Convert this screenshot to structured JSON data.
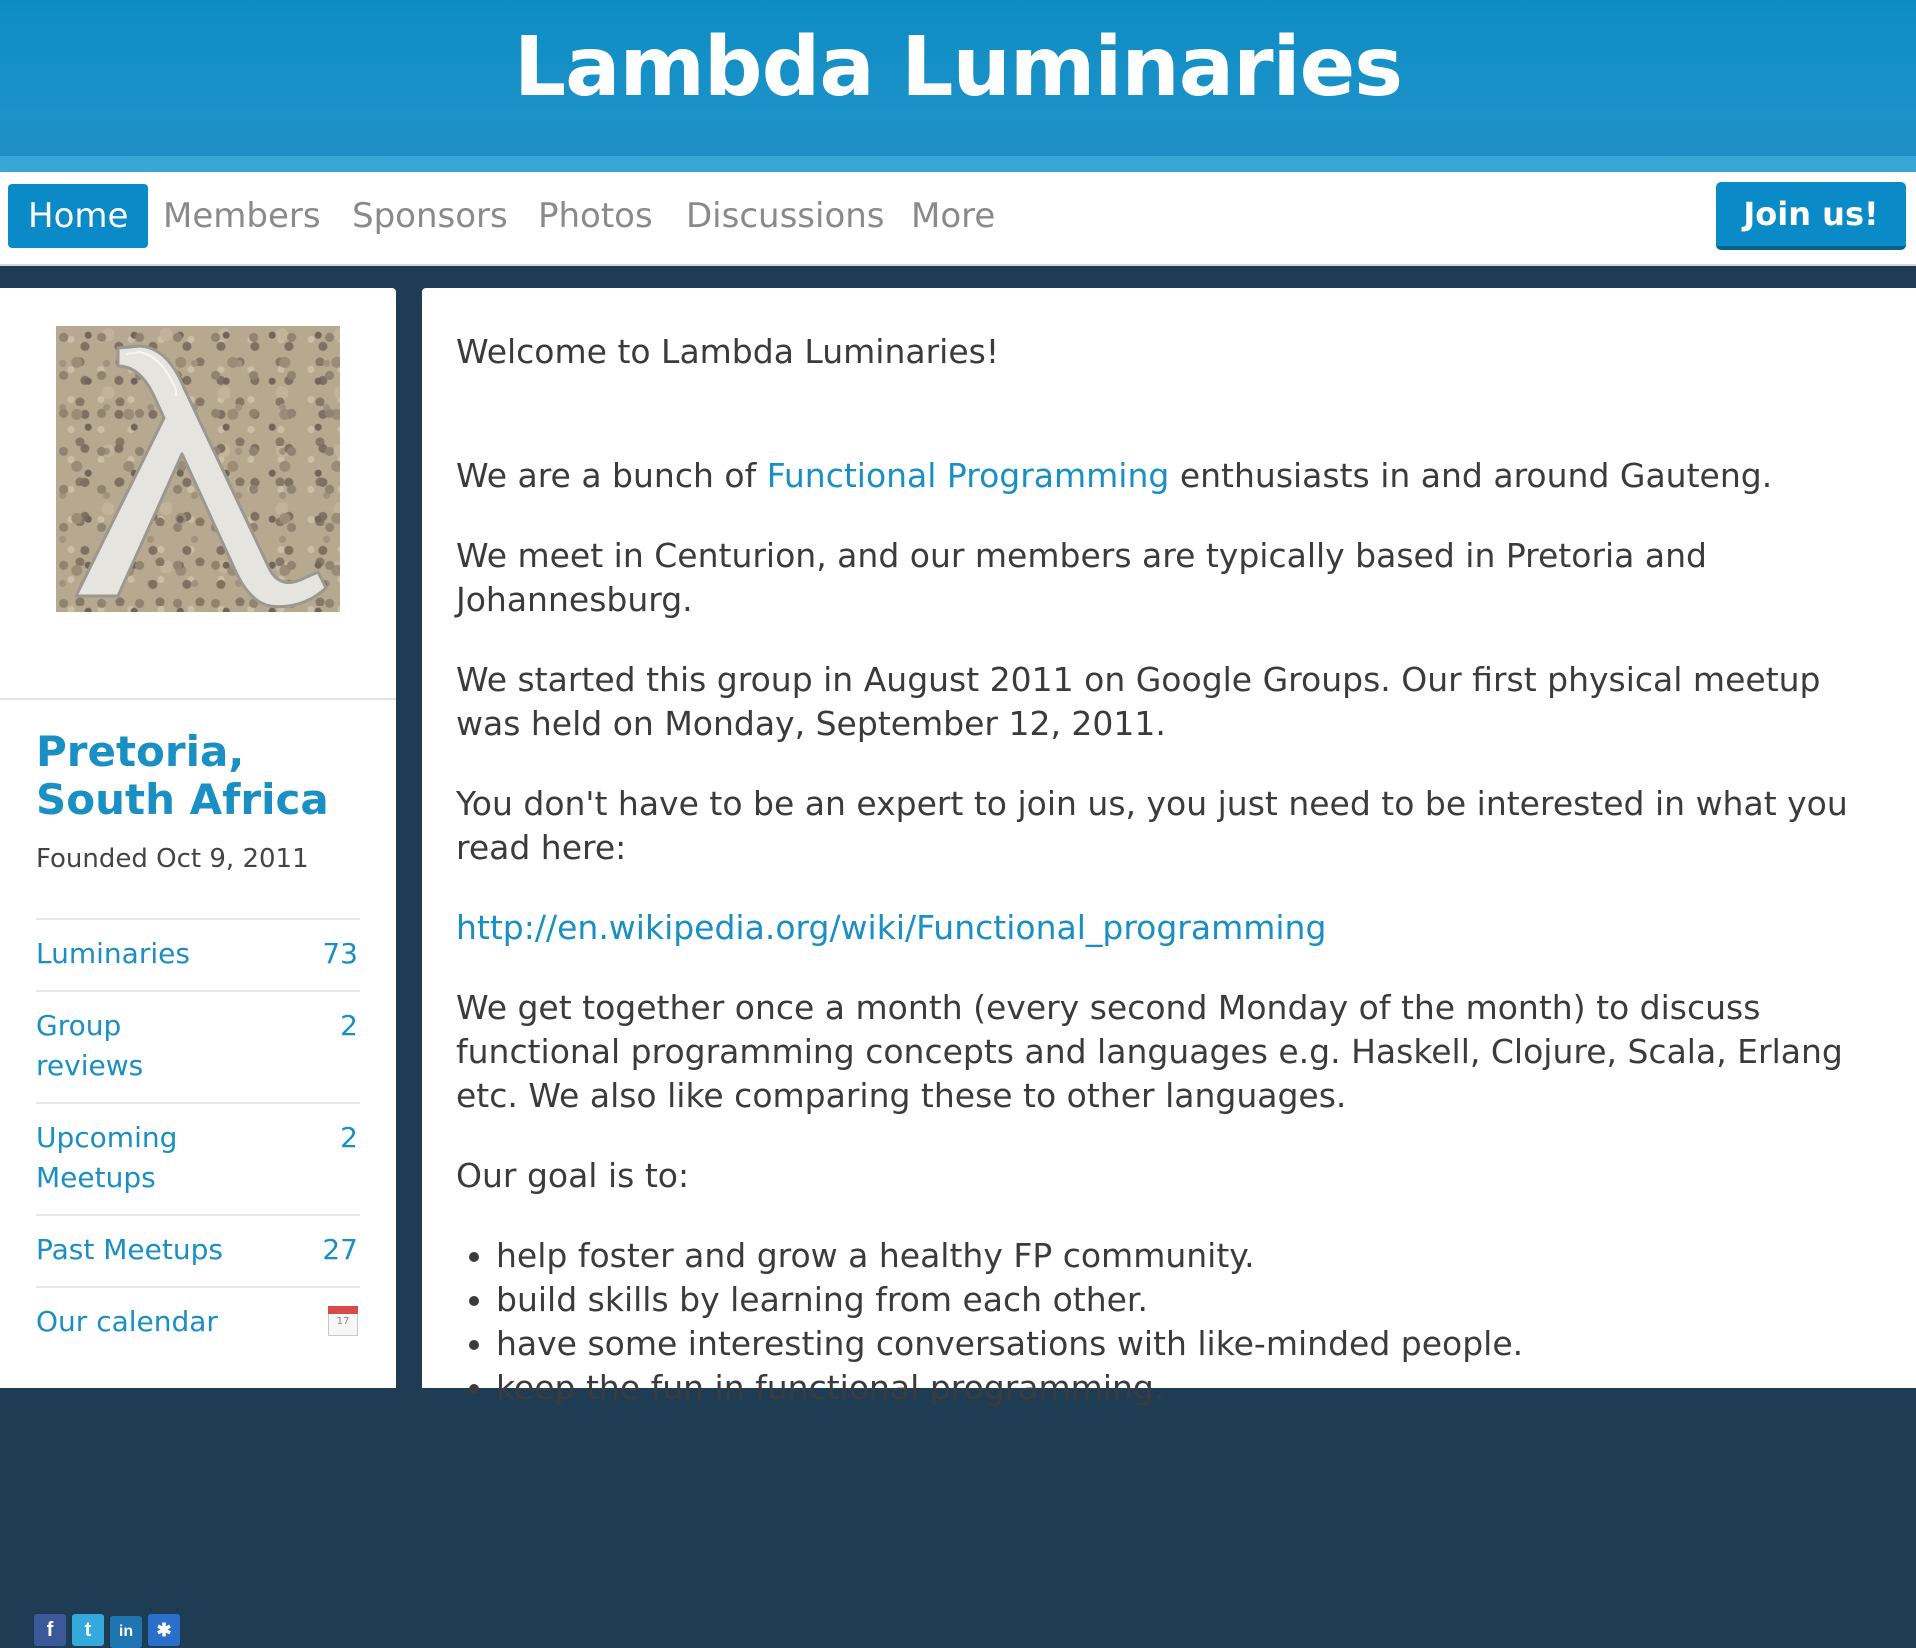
{
  "header": {
    "title": "Lambda Luminaries"
  },
  "nav": {
    "tabs": [
      "Home",
      "Members",
      "Sponsors",
      "Photos",
      "Discussions",
      "More"
    ],
    "join_label": "Join us!"
  },
  "sidebar": {
    "location": "Pretoria, South Africa",
    "founded": "Founded Oct 9, 2011",
    "stats": [
      {
        "label": "Luminaries",
        "count": "73"
      },
      {
        "label": "Group reviews",
        "count": "2"
      },
      {
        "label": "Upcoming Meetups",
        "count": "2"
      },
      {
        "label": "Past Meetups",
        "count": "27"
      },
      {
        "label": "Our calendar",
        "count": ""
      }
    ],
    "calendar_icon_text": "17",
    "social_icons": [
      "facebook-icon",
      "twitter-icon",
      "linkedin-icon",
      "share-icon"
    ]
  },
  "main": {
    "welcome": "Welcome to Lambda Luminaries!",
    "p1_pre": "We are a bunch of ",
    "p1_link": "Functional Programming",
    "p1_post": " enthusiasts in and around Gauteng.",
    "p2": "We meet in Centurion, and our members are typically based in Pretoria and Johannesburg.",
    "p3": "We started this group in August 2011 on Google Groups. Our first physical meetup was held on Monday, September 12, 2011.",
    "p4": "You don't have to be an expert to join us, you just need to be interested in what you read here:",
    "wiki_link": "http://en.wikipedia.org/wiki/Functional_programming",
    "p5": "We get together once a month (every second Monday of the month) to discuss functional programming concepts and languages e.g. Haskell, Clojure, Scala, Erlang etc. We also like comparing these to other languages.",
    "goal_intro": "Our goal is to:",
    "goals": [
      "help foster and grow a healthy FP community.",
      "build skills by learning from each other.",
      "have some interesting conversations with like-minded people.",
      "keep the fun in functional programming."
    ]
  },
  "colors": {
    "brand_blue": "#0a8bc7",
    "link_blue": "#1a8fc4",
    "dark_background": "#1e3d55"
  }
}
